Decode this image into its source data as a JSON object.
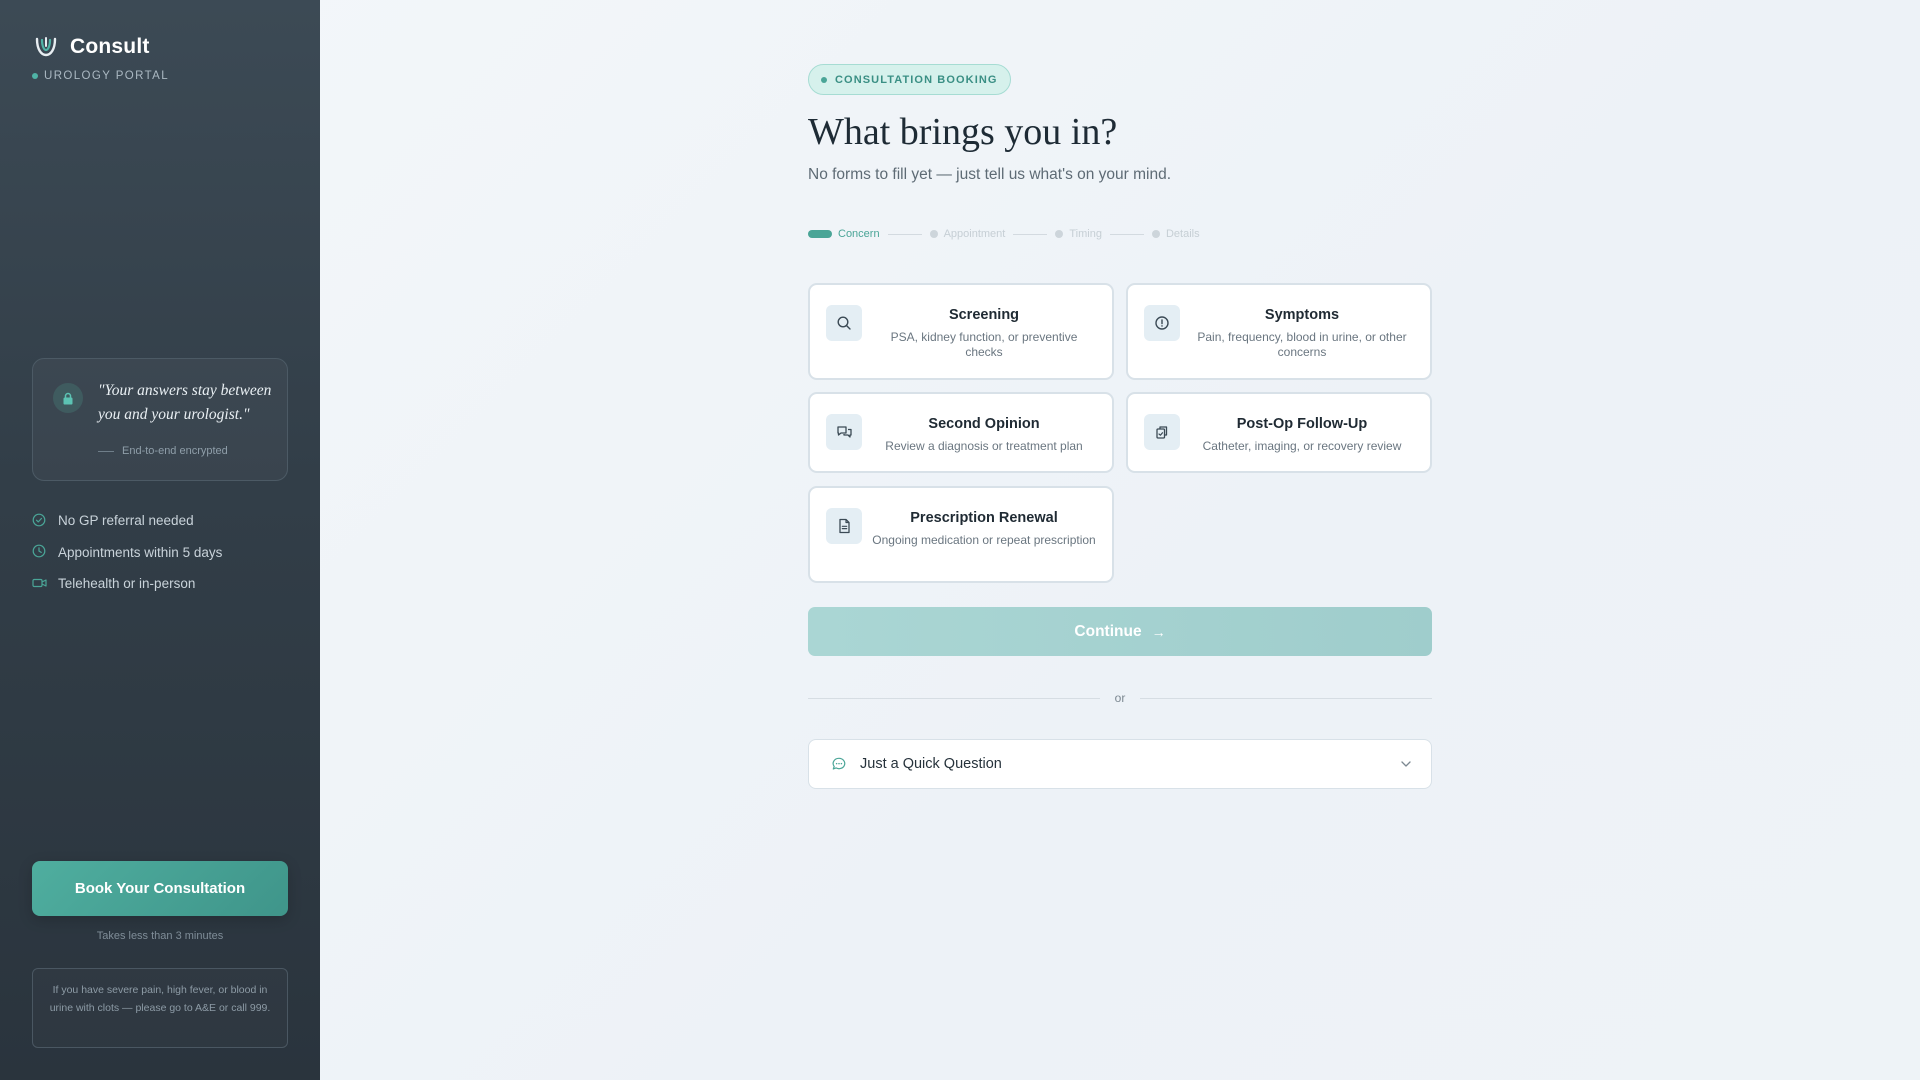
{
  "sidebar": {
    "brand": "Consult",
    "portal_label": "UROLOGY PORTAL",
    "quote": "\"Your answers stay between you and your urologist.\"",
    "quote_footer": "End-to-end encrypted",
    "features": [
      {
        "label": "No GP referral needed",
        "icon": "check-circle-icon"
      },
      {
        "label": "Appointments within 5 days",
        "icon": "clock-icon"
      },
      {
        "label": "Telehealth or in-person",
        "icon": "video-camera-icon"
      }
    ],
    "book_button": "Book Your Consultation",
    "book_subtext": "Takes less than 3 minutes",
    "emergency_notice": "If you have severe pain, high fever, or blood in urine with clots — please go to A&E or call 999."
  },
  "main": {
    "badge": "CONSULTATION BOOKING",
    "title": "What brings you in?",
    "subtitle": "No forms to fill yet — just tell us what's on your mind.",
    "steps": [
      {
        "label": "Concern",
        "active": true
      },
      {
        "label": "Appointment",
        "active": false
      },
      {
        "label": "Timing",
        "active": false
      },
      {
        "label": "Details",
        "active": false
      }
    ],
    "options": [
      {
        "title": "Screening",
        "description": "PSA, kidney function, or preventive checks",
        "icon": "search-icon"
      },
      {
        "title": "Symptoms",
        "description": "Pain, frequency, blood in urine, or other concerns",
        "icon": "alert-circle-icon"
      },
      {
        "title": "Second Opinion",
        "description": "Review a diagnosis or treatment plan",
        "icon": "chat-bubbles-icon"
      },
      {
        "title": "Post-Op Follow-Up",
        "description": "Catheter, imaging, or recovery review",
        "icon": "clipboard-copy-icon"
      },
      {
        "title": "Prescription Renewal",
        "description": "Ongoing medication or repeat prescription",
        "icon": "document-icon"
      }
    ],
    "continue_label": "Continue",
    "continue_arrow": "→",
    "divider_text": "or",
    "quick_question": "Just a Quick Question"
  },
  "colors": {
    "accent": "#4aa597",
    "sidebar_bg": "#323e48",
    "continue_disabled": "#a6d3d2"
  }
}
